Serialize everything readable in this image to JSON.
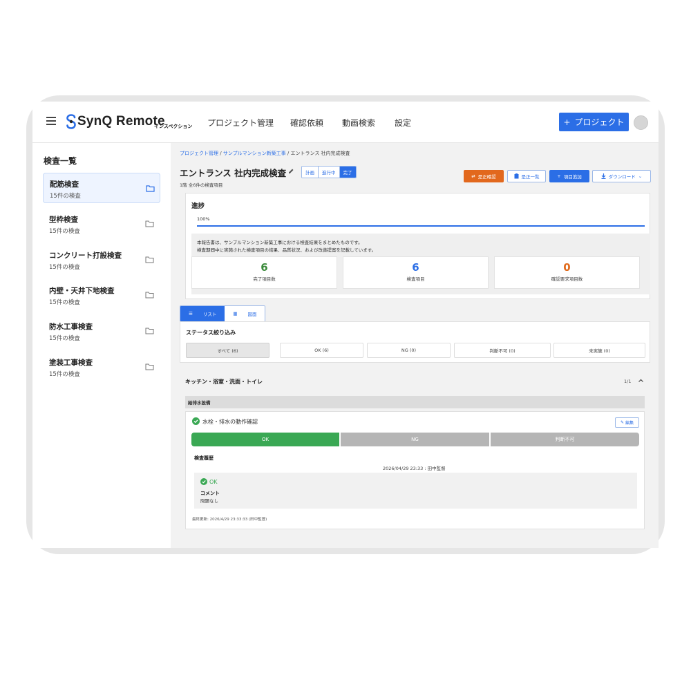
{
  "header": {
    "brand": "SynQ Remote",
    "brand_sub": "インスペクション",
    "nav": [
      "プロジェクト管理",
      "確認依頼",
      "動画検索",
      "設定"
    ],
    "new_project_label": "プロジェクト",
    "colors": {
      "primary": "#2b6ee6"
    }
  },
  "sidebar": {
    "title": "検査一覧",
    "items": [
      {
        "name": "配筋検査",
        "count": "15件の検査"
      },
      {
        "name": "型枠検査",
        "count": "15件の検査"
      },
      {
        "name": "コンクリート打設検査",
        "count": "15件の検査"
      },
      {
        "name": "内壁・天井下地検査",
        "count": "15件の検査"
      },
      {
        "name": "防水工事検査",
        "count": "15件の検査"
      },
      {
        "name": "塗装工事検査",
        "count": "15件の検査"
      }
    ]
  },
  "main": {
    "breadcrumb": {
      "crumb1": "プロジェクト管理",
      "crumb2": "サンプルマンション新築工事",
      "current": "エントランス 社内完成検査",
      "sep": "/"
    },
    "title": "エントランス 社内完成検査",
    "status_segments": [
      "計画",
      "進行中",
      "完了"
    ],
    "subinfo": "1階  全6件の検査項目",
    "toolbar": {
      "correction_confirm": "是正確認",
      "correction_list": "是正一覧",
      "add_item": "項目追加",
      "download": "ダウンロード"
    },
    "progress": {
      "title": "進捗",
      "percent_label": "100%",
      "percent": 100,
      "description_line1": "本報告書は、サンプルマンション新築工事における検査結果をまとめたものです。",
      "description_line2": "検査期間中に実施された検査項目の結果、品質状況、および改善提案を記載しています。",
      "stats": [
        {
          "value": "6",
          "label": "完了項目数",
          "color": "#3a8a3a"
        },
        {
          "value": "6",
          "label": "検査項目",
          "color": "#2b6ee6"
        },
        {
          "value": "0",
          "label": "確認要求項目数",
          "color": "#e06a1b"
        }
      ]
    },
    "view_toggle": {
      "list": "リスト",
      "drawing": "図面"
    },
    "filter": {
      "title": "ステータス絞り込み",
      "options": [
        "すべて (6)",
        "OK (6)",
        "NG (0)",
        "判断不可 (0)",
        "未実施 (0)"
      ]
    },
    "section": {
      "title": "キッチン・浴室・洗面・トイレ",
      "page": "1/1",
      "subheading": "給排水設備",
      "item": {
        "name": "水栓・排水の動作確認",
        "edit_label": "編集",
        "results": [
          "OK",
          "NG",
          "判断不可"
        ],
        "history_title": "検査履歴",
        "history_meta": "2026/04/29 23:33  : 田中監督",
        "history_status": "OK",
        "comment_label": "コメント",
        "comment_value": "問題なし",
        "last_updated": "最終更新: 2026/4/29 23:33:33 (田中監督)"
      }
    }
  }
}
